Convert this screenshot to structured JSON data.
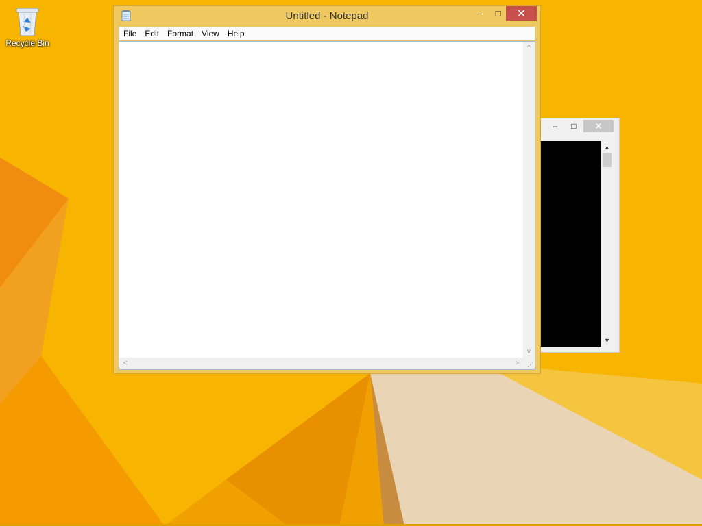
{
  "desktop": {
    "icons": [
      {
        "label": "Recycle Bin",
        "icon": "recycle-bin-icon"
      }
    ]
  },
  "notepad": {
    "title": "Untitled - Notepad",
    "app_icon": "notepad-icon",
    "controls": {
      "minimize": "–",
      "maximize": "□",
      "close": "✕"
    },
    "menu": [
      "File",
      "Edit",
      "Format",
      "View",
      "Help"
    ],
    "content": "",
    "scroll": {
      "up": "^",
      "down": "v",
      "left": "<",
      "right": ">"
    },
    "accent_color": "#f0c860"
  },
  "console_window": {
    "controls": {
      "minimize": "–",
      "maximize": "□",
      "close": "✕"
    },
    "background_color": "#000000"
  },
  "colors": {
    "desktop_background": "#f7b400",
    "close_button": "#c7504d"
  }
}
